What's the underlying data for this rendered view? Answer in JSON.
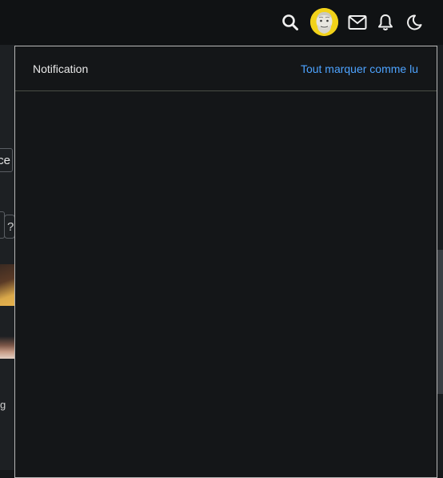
{
  "header": {
    "icons": [
      "search-icon",
      "avatar",
      "mail-icon",
      "bell-icon",
      "moon-icon"
    ]
  },
  "background": {
    "partial_button_text": "ce",
    "partial_help_text": "?",
    "partial_text": "g"
  },
  "notifications": {
    "title": "Notification",
    "mark_all_read": "Tout marquer comme lu"
  },
  "colors": {
    "accent": "#4da3ff",
    "panel_bg": "#141618",
    "topbar_bg": "#101214",
    "avatar_bg": "#f2d21a"
  }
}
